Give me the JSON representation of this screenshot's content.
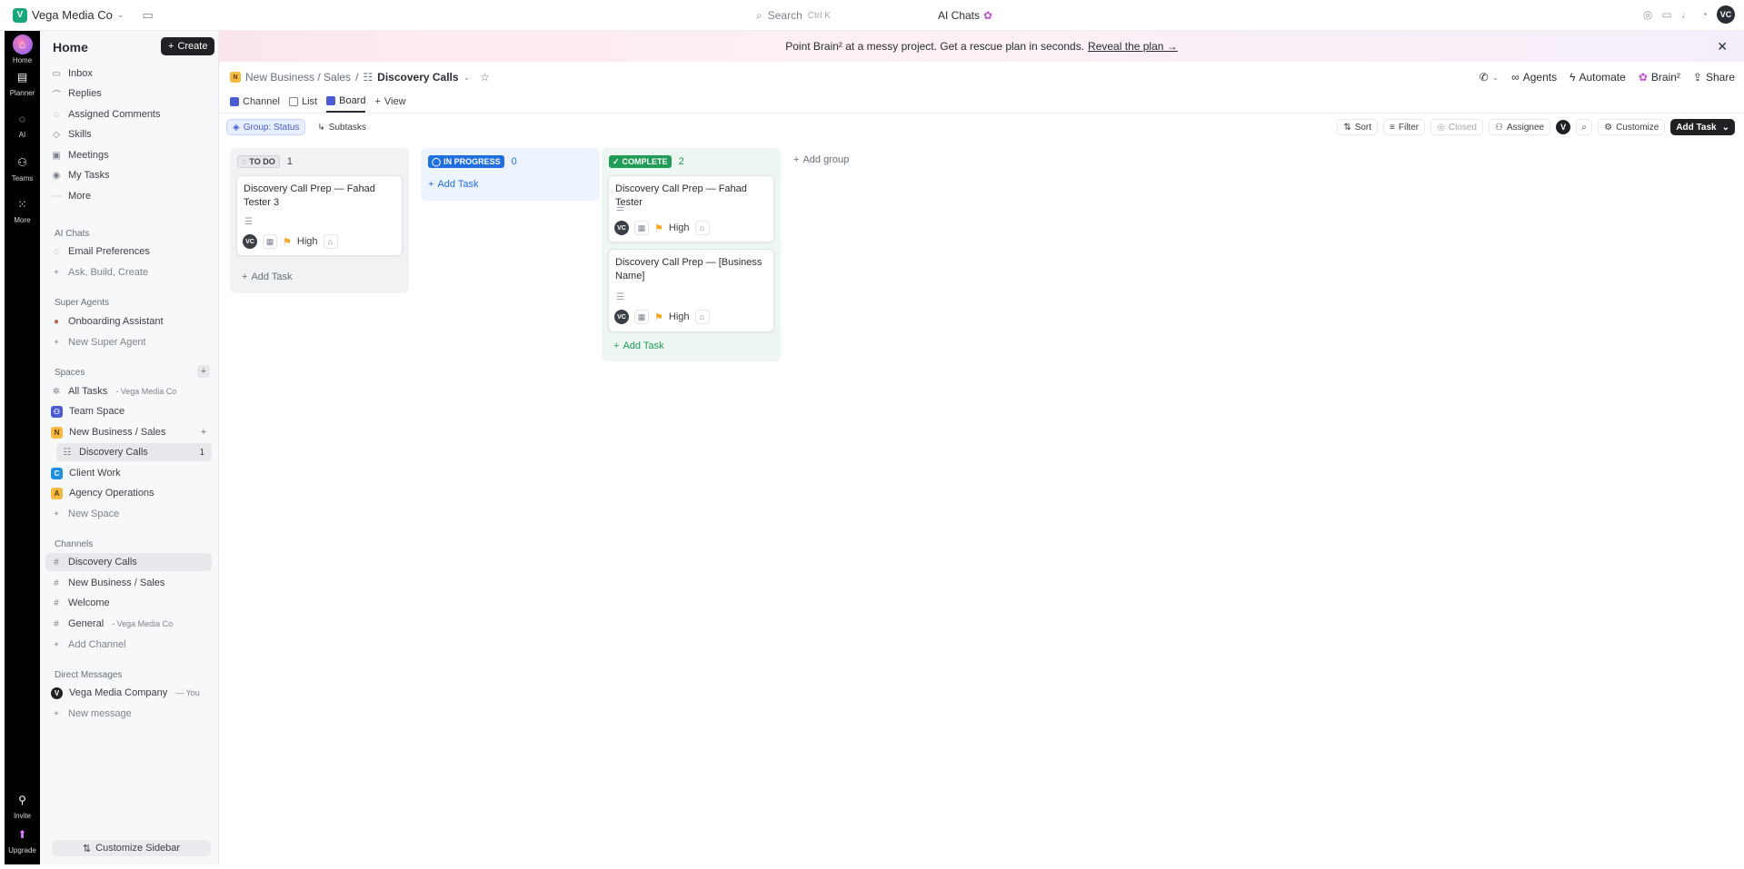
{
  "topbar": {
    "workspace": "Vega Media Co",
    "workspace_initial": "V",
    "search_placeholder": "Search",
    "search_shortcut": "Ctrl K",
    "ai_chats": "AI Chats",
    "avatar": "VC"
  },
  "rail": {
    "items": [
      {
        "label": "Home",
        "icon": "home-icon"
      },
      {
        "label": "Planner",
        "icon": "planner-icon"
      },
      {
        "label": "AI",
        "icon": "ai-icon"
      },
      {
        "label": "Teams",
        "icon": "teams-icon"
      },
      {
        "label": "More",
        "icon": "grid-icon"
      },
      {
        "label": "Invite",
        "icon": "invite-icon"
      },
      {
        "label": "Upgrade",
        "icon": "upgrade-icon"
      }
    ]
  },
  "sidebar": {
    "title": "Home",
    "create": "Create",
    "nav": [
      {
        "label": "Inbox",
        "icon": "inbox-icon"
      },
      {
        "label": "Replies",
        "icon": "replies-icon"
      },
      {
        "label": "Assigned Comments",
        "icon": "comments-icon"
      },
      {
        "label": "Skills",
        "icon": "skills-icon"
      },
      {
        "label": "Meetings",
        "icon": "meetings-icon"
      },
      {
        "label": "My Tasks",
        "icon": "tasks-icon"
      },
      {
        "label": "More",
        "icon": "more-icon"
      }
    ],
    "ai_chats_head": "AI Chats",
    "ai_chats": [
      "Email Preferences",
      "Ask, Build, Create"
    ],
    "super_agents_head": "Super Agents",
    "super_agents": [
      "Onboarding Assistant",
      "New Super Agent"
    ],
    "spaces_head": "Spaces",
    "spaces": {
      "all_tasks": "All Tasks",
      "all_tasks_sub": "- Vega Media Co",
      "team_space": "Team Space",
      "new_business": "New Business / Sales",
      "discovery_calls": "Discovery Calls",
      "discovery_calls_count": "1",
      "client_work": "Client Work",
      "agency_operations": "Agency Operations",
      "new_space": "New Space"
    },
    "channels_head": "Channels",
    "channels": {
      "discovery_calls": "Discovery Calls",
      "new_business": "New Business / Sales",
      "welcome": "Welcome",
      "general": "General",
      "general_sub": "- Vega Media Co",
      "add_channel": "Add Channel"
    },
    "dm_head": "Direct Messages",
    "dm": {
      "vega": "Vega Media Company",
      "vega_sub": "— You",
      "new_message": "New message"
    },
    "customize": "Customize Sidebar"
  },
  "banner": {
    "text": "Point Brain² at a messy project. Get a rescue plan in seconds.",
    "link": "Reveal the plan →"
  },
  "header": {
    "crumb_parent": "New Business / Sales",
    "crumb_current": "Discovery Calls",
    "agents": "Agents",
    "automate": "Automate",
    "brain": "Brain²",
    "share": "Share"
  },
  "views": {
    "channel": "Channel",
    "list": "List",
    "board": "Board",
    "add_view": "View"
  },
  "toolbar": {
    "group": "Group: Status",
    "subtasks": "Subtasks",
    "sort": "Sort",
    "filter": "Filter",
    "closed": "Closed",
    "assignee": "Assignee",
    "user_initial": "V",
    "customize": "Customize",
    "add_task": "Add Task"
  },
  "board": {
    "columns": [
      {
        "status": "TO DO",
        "count": "1",
        "color": "#656f7d",
        "cards": [
          {
            "title": "Discovery Call Prep — Fahad Tester 3",
            "assignee": "VC",
            "priority": "High"
          }
        ],
        "add_task": "Add Task"
      },
      {
        "status": "IN PROGRESS",
        "count": "0",
        "color": "#1f6fe0",
        "cards": [],
        "add_task": "Add Task"
      },
      {
        "status": "COMPLETE",
        "count": "2",
        "color": "#1f9d57",
        "cards": [
          {
            "title": "Discovery Call Prep — Fahad Tester",
            "assignee": "VC",
            "priority": "High"
          },
          {
            "title": "Discovery Call Prep — [Business Name]",
            "assignee": "VC",
            "priority": "High"
          }
        ],
        "add_task": "Add Task"
      }
    ],
    "add_group": "Add group"
  }
}
